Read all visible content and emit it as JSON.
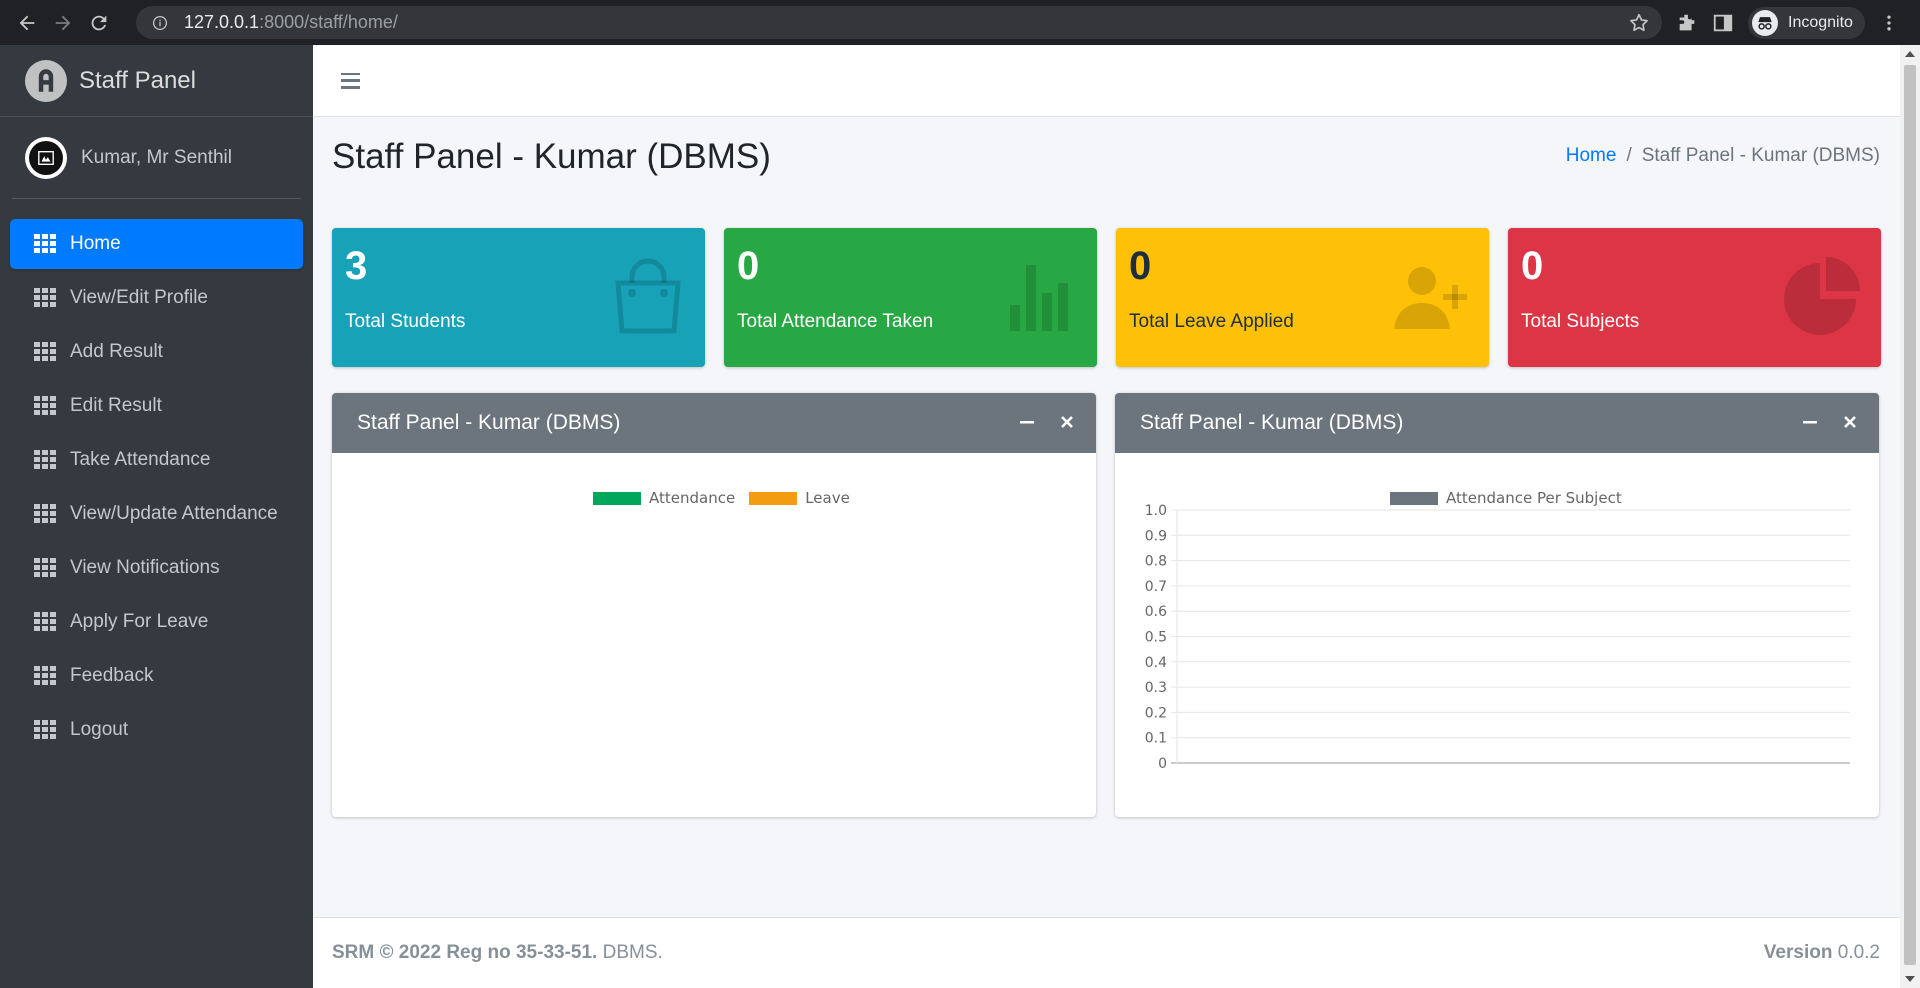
{
  "browser": {
    "url_host": "127.0.0.1",
    "url_path": ":8000/staff/home/",
    "profile_label": "Incognito"
  },
  "sidebar": {
    "brand": "Staff Panel",
    "user_name": "Kumar, Mr Senthil",
    "items": [
      {
        "label": "Home",
        "icon": "grid-icon",
        "active": true
      },
      {
        "label": "View/Edit Profile",
        "icon": "grid-icon"
      },
      {
        "label": "Add Result",
        "icon": "grid-icon"
      },
      {
        "label": "Edit Result",
        "icon": "grid-icon"
      },
      {
        "label": "Take Attendance",
        "icon": "grid-icon"
      },
      {
        "label": "View/Update Attendance",
        "icon": "grid-icon"
      },
      {
        "label": "View Notifications",
        "icon": "grid-icon"
      },
      {
        "label": "Apply For Leave",
        "icon": "grid-icon"
      },
      {
        "label": "Feedback",
        "icon": "grid-icon"
      },
      {
        "label": "Logout",
        "icon": "grid-icon"
      }
    ]
  },
  "header": {
    "page_title": "Staff Panel - Kumar (DBMS)",
    "breadcrumb_home": "Home",
    "breadcrumb_sep": "/",
    "breadcrumb_current": "Staff Panel - Kumar (DBMS)"
  },
  "stats": [
    {
      "value": "3",
      "label": "Total Students",
      "color": "#17a2b8",
      "icon": "shopping-bag-icon"
    },
    {
      "value": "0",
      "label": "Total Attendance Taken",
      "color": "#28a745",
      "icon": "bar-chart-icon"
    },
    {
      "value": "0",
      "label": "Total Leave Applied",
      "color": "#ffc107",
      "icon": "user-plus-icon"
    },
    {
      "value": "0",
      "label": "Total Subjects",
      "color": "#dc3545",
      "icon": "pie-chart-icon"
    }
  ],
  "cards": [
    {
      "title": "Staff Panel - Kumar (DBMS)",
      "legend": [
        {
          "label": "Attendance",
          "color": "#00a65a"
        },
        {
          "label": "Leave",
          "color": "#f39c12"
        }
      ]
    },
    {
      "title": "Staff Panel - Kumar (DBMS)",
      "legend": [
        {
          "label": "Attendance Per Subject",
          "color": "#6c757d"
        }
      ]
    }
  ],
  "chart_data": {
    "type": "bar",
    "categories": [],
    "series": [
      {
        "name": "Attendance Per Subject",
        "values": []
      }
    ],
    "ylim": [
      0,
      1.0
    ],
    "yticks": [
      "1.0",
      "0.9",
      "0.8",
      "0.7",
      "0.6",
      "0.5",
      "0.4",
      "0.3",
      "0.2",
      "0.1",
      "0"
    ],
    "grid": true,
    "legend": "top"
  },
  "footer": {
    "left_bold": "SRM © 2022 Reg no 35-33-51.",
    "left_rest": " DBMS.",
    "version_label": "Version",
    "version_value": " 0.0.2"
  }
}
